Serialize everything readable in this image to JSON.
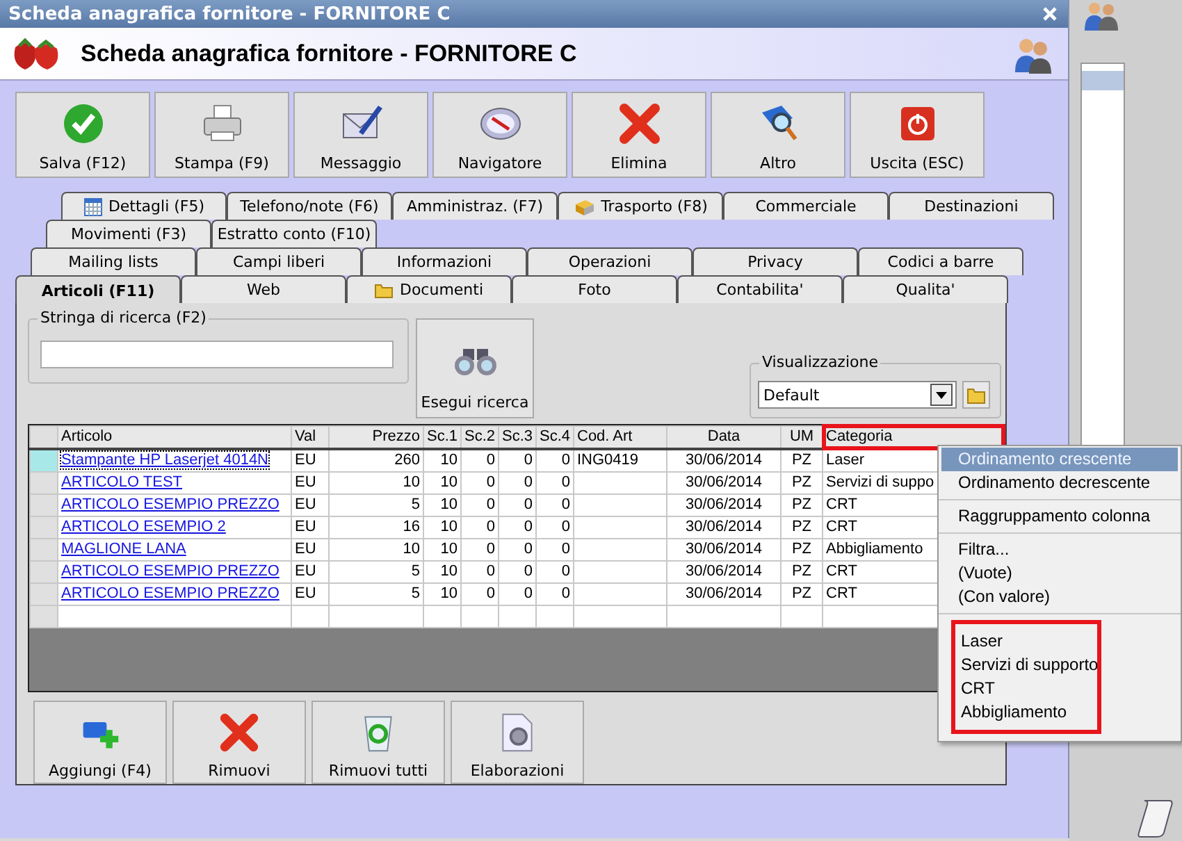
{
  "window": {
    "title": "Scheda anagrafica fornitore - FORNITORE C"
  },
  "header": {
    "title": "Scheda anagrafica fornitore - FORNITORE C"
  },
  "toolbar": [
    {
      "label": "Salva (F12)",
      "kind": "check"
    },
    {
      "label": "Stampa (F9)",
      "kind": "printer"
    },
    {
      "label": "Messaggio",
      "kind": "envelope"
    },
    {
      "label": "Navigatore",
      "kind": "compass"
    },
    {
      "label": "Elimina",
      "kind": "cross"
    },
    {
      "label": "Altro",
      "kind": "book"
    },
    {
      "label": "Uscita (ESC)",
      "kind": "power"
    }
  ],
  "tab_rows": [
    {
      "tabs": [
        {
          "label": "Dettagli (F5)",
          "kind": "calendar",
          "selected": false
        },
        {
          "label": "Telefono/note (F6)",
          "selected": false
        },
        {
          "label": "Amministraz. (F7)",
          "selected": false
        },
        {
          "label": "Trasporto (F8)",
          "kind": "truck",
          "selected": false
        },
        {
          "label": "Commerciale",
          "selected": false
        },
        {
          "label": "Destinazioni",
          "selected": false
        }
      ]
    },
    {
      "tabs": [
        {
          "label": "Movimenti (F3)",
          "selected": false
        },
        {
          "label": "Estratto conto (F10)",
          "selected": false
        }
      ]
    },
    {
      "tabs": [
        {
          "label": "Mailing lists",
          "selected": false
        },
        {
          "label": "Campi liberi",
          "selected": false
        },
        {
          "label": "Informazioni",
          "selected": false
        },
        {
          "label": "Operazioni",
          "selected": false
        },
        {
          "label": "Privacy",
          "selected": false
        },
        {
          "label": "Codici a barre",
          "selected": false
        }
      ]
    },
    {
      "tabs": [
        {
          "label": "Articoli (F11)",
          "selected": true
        },
        {
          "label": "Web",
          "selected": false
        },
        {
          "label": "Documenti",
          "kind": "folder",
          "selected": false
        },
        {
          "label": "Foto",
          "selected": false
        },
        {
          "label": "Contabilita'",
          "selected": false
        },
        {
          "label": "Qualita'",
          "selected": false
        }
      ]
    }
  ],
  "search": {
    "label": "Stringa di ricerca (F2)",
    "button": "Esegui ricerca"
  },
  "view": {
    "label": "Visualizzazione",
    "value": "Default"
  },
  "table": {
    "columns": [
      {
        "label": "Articolo",
        "kind": "text",
        "highlighted": false
      },
      {
        "label": "Val",
        "kind": "text",
        "highlighted": false
      },
      {
        "label": "Prezzo",
        "kind": "number",
        "highlighted": false
      },
      {
        "label": "Sc.1",
        "kind": "number",
        "highlighted": false
      },
      {
        "label": "Sc.2",
        "kind": "number",
        "highlighted": false
      },
      {
        "label": "Sc.3",
        "kind": "number",
        "highlighted": false
      },
      {
        "label": "Sc.4",
        "kind": "number",
        "highlighted": false
      },
      {
        "label": "Cod. Art",
        "kind": "text",
        "highlighted": false
      },
      {
        "label": "Data",
        "kind": "center",
        "highlighted": false
      },
      {
        "label": "UM",
        "kind": "center",
        "highlighted": false
      },
      {
        "label": "Categoria",
        "kind": "text",
        "highlighted": true
      }
    ],
    "rows": [
      {
        "selected": true,
        "cells": [
          "Stampante HP Laserjet 4014N",
          "EU",
          "260",
          "10",
          "0",
          "0",
          "0",
          "ING0419",
          "30/06/2014",
          "PZ",
          "Laser"
        ]
      },
      {
        "selected": false,
        "cells": [
          "ARTICOLO TEST",
          "EU",
          "10",
          "10",
          "0",
          "0",
          "0",
          "",
          "30/06/2014",
          "PZ",
          "Servizi di suppo"
        ]
      },
      {
        "selected": false,
        "cells": [
          "ARTICOLO ESEMPIO PREZZO",
          "EU",
          "5",
          "10",
          "0",
          "0",
          "0",
          "",
          "30/06/2014",
          "PZ",
          "CRT"
        ]
      },
      {
        "selected": false,
        "cells": [
          "ARTICOLO ESEMPIO 2",
          "EU",
          "16",
          "10",
          "0",
          "0",
          "0",
          "",
          "30/06/2014",
          "PZ",
          "CRT"
        ]
      },
      {
        "selected": false,
        "cells": [
          "MAGLIONE LANA",
          "EU",
          "10",
          "10",
          "0",
          "0",
          "0",
          "",
          "30/06/2014",
          "PZ",
          "Abbigliamento"
        ]
      },
      {
        "selected": false,
        "cells": [
          "ARTICOLO ESEMPIO PREZZO",
          "EU",
          "5",
          "10",
          "0",
          "0",
          "0",
          "",
          "30/06/2014",
          "PZ",
          "CRT"
        ]
      },
      {
        "selected": false,
        "cells": [
          "ARTICOLO ESEMPIO PREZZO",
          "EU",
          "5",
          "10",
          "0",
          "0",
          "0",
          "",
          "30/06/2014",
          "PZ",
          "CRT"
        ]
      }
    ]
  },
  "context_menu": {
    "groups": [
      {
        "highlighted": false,
        "items": [
          {
            "label": "Ordinamento crescente",
            "selected": true
          },
          {
            "label": "Ordinamento decrescente",
            "selected": false
          }
        ]
      },
      {
        "highlighted": false,
        "items": [
          {
            "label": "Raggruppamento colonna",
            "selected": false
          }
        ]
      },
      {
        "highlighted": false,
        "items": [
          {
            "label": "Filtra...",
            "selected": false
          },
          {
            "label": "(Vuote)",
            "selected": false
          },
          {
            "label": "(Con valore)",
            "selected": false
          }
        ]
      },
      {
        "highlighted": true,
        "items": [
          {
            "label": "Laser",
            "selected": false
          },
          {
            "label": "Servizi di supporto",
            "selected": false
          },
          {
            "label": "CRT",
            "selected": false
          },
          {
            "label": "Abbigliamento",
            "selected": false
          }
        ]
      }
    ]
  },
  "bottom_buttons": [
    {
      "label": "Aggiungi (F4)",
      "kind": "add"
    },
    {
      "label": "Rimuovi",
      "kind": "cross"
    },
    {
      "label": "Rimuovi tutti",
      "kind": "bin"
    },
    {
      "label": "Elaborazioni",
      "kind": "gear-doc"
    }
  ]
}
